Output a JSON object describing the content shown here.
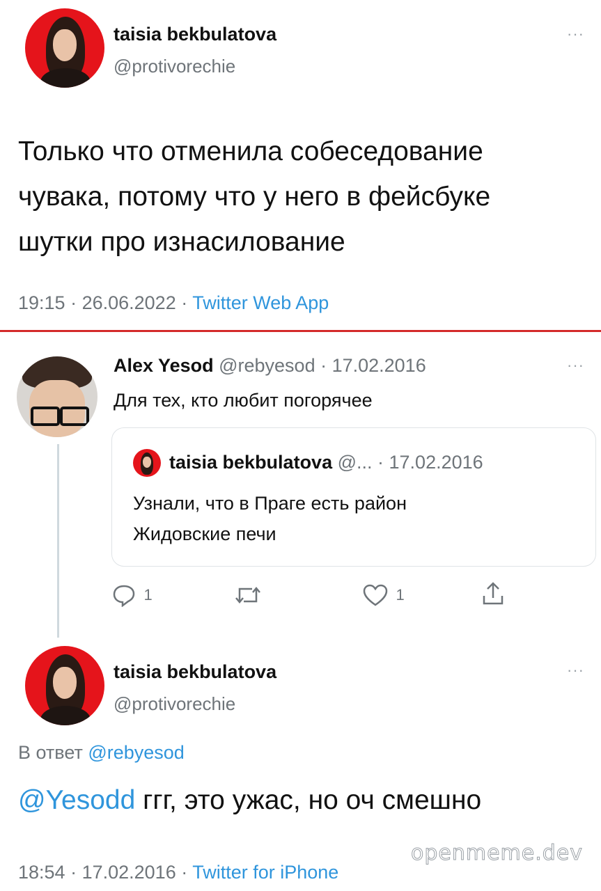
{
  "main_tweet": {
    "author_name": "taisia bekbulatova",
    "handle": "@protivorechie",
    "text_lines": [
      "Только что отменила собеседование",
      "чувака, потому что у него в фейсбуке",
      "шутки про изнасилование"
    ],
    "time": "19:15",
    "date": "26.06.2022",
    "source": "Twitter Web App",
    "separator": " · "
  },
  "reply_thread": {
    "author_name": "Alex Yesod",
    "handle_date": "@rebyesod · 17.02.2016",
    "text": "Для тех, кто любит погорячее",
    "quoted": {
      "author_name": "taisia bekbulatova",
      "handle_date": "@... · 17.02.2016",
      "text_lines": [
        "Узнали, что в Праге есть район",
        "Жидовские печи"
      ]
    },
    "actions": {
      "reply_count": "1",
      "like_count": "1"
    }
  },
  "reply_tweet": {
    "author_name": "taisia bekbulatova",
    "handle": "@protivorechie",
    "reply_prefix": "В ответ",
    "reply_to": "@rebyesod",
    "mention": "@Yesodd",
    "text": " ггг, это ужас, но оч смешно",
    "time": "18:54",
    "date": "17.02.2016",
    "source": "Twitter for iPhone",
    "separator": " · "
  },
  "watermark": "openmeme.dev",
  "more_label": "···",
  "colors": {
    "link": "#2f95dc",
    "divider": "#d42a2a",
    "avatar_bg": "#e5141b",
    "muted": "#6e7479"
  }
}
